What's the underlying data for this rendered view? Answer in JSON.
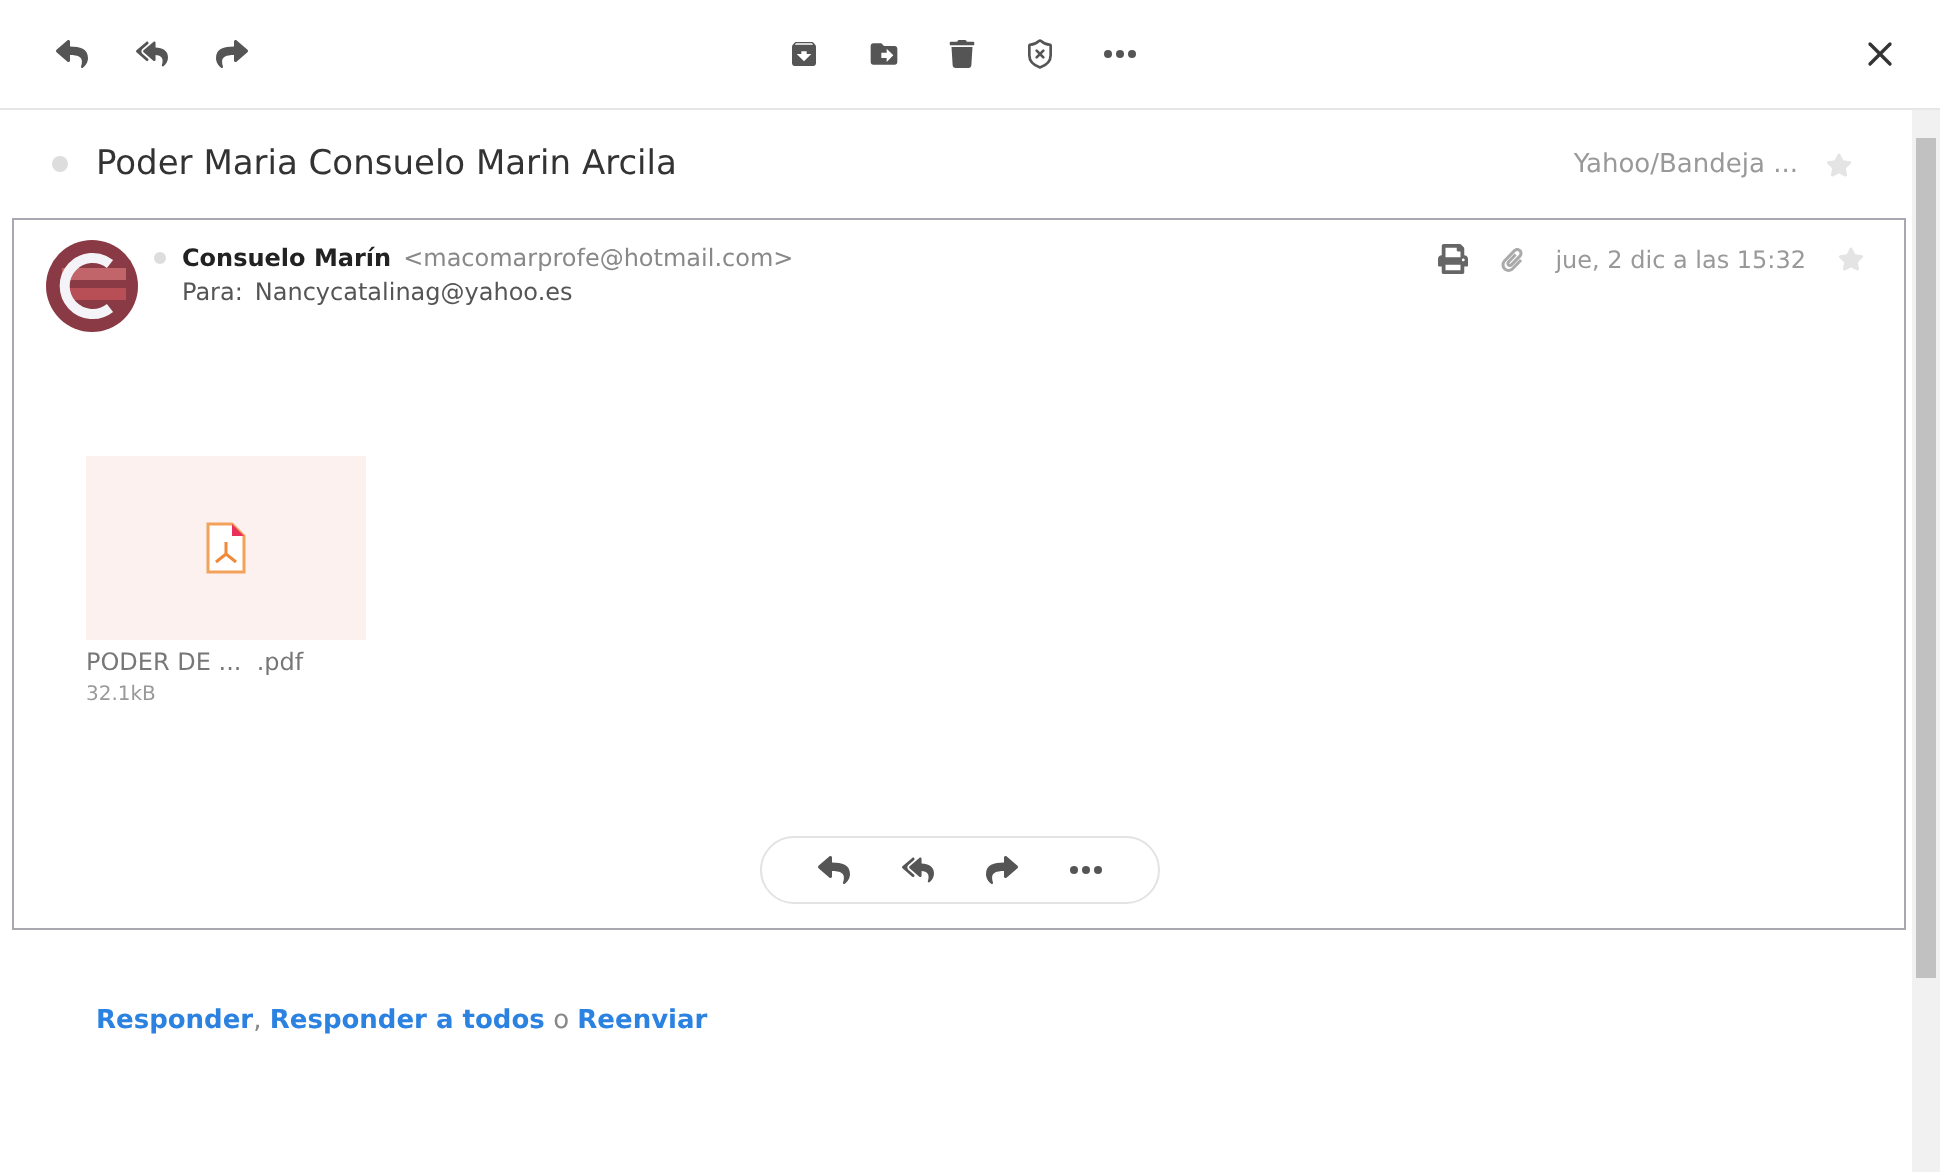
{
  "toolbar": {
    "left": [
      {
        "kind": "reply"
      },
      {
        "kind": "reply_all"
      },
      {
        "kind": "forward"
      }
    ],
    "center": [
      {
        "kind": "archive"
      },
      {
        "kind": "move"
      },
      {
        "kind": "delete"
      },
      {
        "kind": "spam"
      },
      {
        "kind": "more"
      }
    ]
  },
  "subject": {
    "title": "Poder Maria Consuelo Marin Arcila",
    "folder": "Yahoo/Bandeja ...",
    "starred": false
  },
  "message": {
    "sender_name": "Consuelo Marín",
    "sender_email": "<macomarprofe@hotmail.com>",
    "to_label": "Para:",
    "to": "Nancycatalinag@yahoo.es",
    "date": "jue, 2 dic a las 15:32",
    "starred": false,
    "attachments": [
      {
        "name": "PODER DE ...  .pdf",
        "size": "32.1kB"
      }
    ],
    "actions": [
      {
        "kind": "reply"
      },
      {
        "kind": "reply_all"
      },
      {
        "kind": "forward"
      },
      {
        "kind": "more"
      }
    ]
  },
  "quick_reply": [
    {
      "kind": "link",
      "text": "Responder"
    },
    {
      "kind": "sep",
      "text": ","
    },
    {
      "kind": "link",
      "text": "Responder a todos"
    },
    {
      "kind": "sep",
      "text": "o"
    },
    {
      "kind": "link",
      "text": "Reenviar"
    }
  ]
}
